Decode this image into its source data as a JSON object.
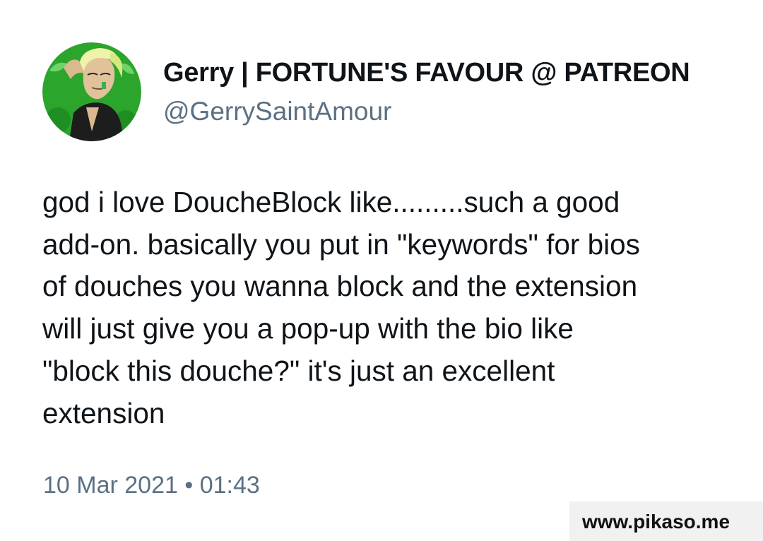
{
  "user": {
    "display_name": "Gerry | FORTUNE'S FAVOUR @ PATREON",
    "handle": "@GerrySaintAmour",
    "avatar_icon": "profile-avatar-illustration"
  },
  "tweet": {
    "lines": [
      "god i love DoucheBlock like.........such a good",
      "add-on. basically you put in \"keywords\" for bios",
      "of douches you wanna block and the extension",
      "will just give you a pop-up with the bio like",
      "\"block this douche?\" it's just an excellent",
      "extension"
    ],
    "timestamp": "10 Mar 2021 • 01:43"
  },
  "watermark": {
    "text": "www.pikaso.me"
  },
  "colors": {
    "text_primary": "#0f1419",
    "text_secondary": "#5b7083",
    "avatar_background": "#2aa52a",
    "watermark_background": "#f1f1f1"
  }
}
